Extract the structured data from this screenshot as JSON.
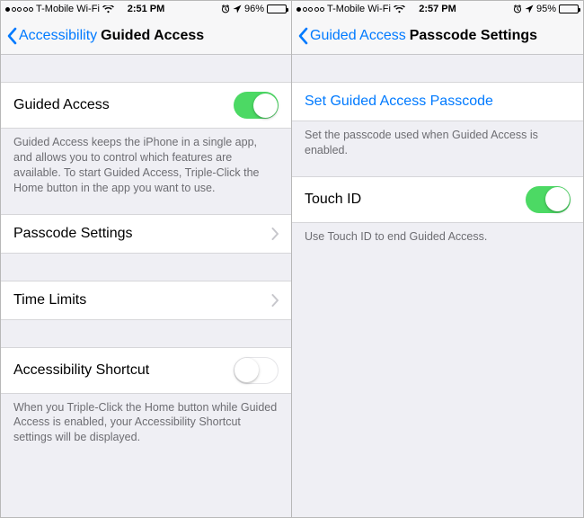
{
  "left": {
    "status": {
      "carrier": "T-Mobile Wi-Fi",
      "time": "2:51 PM",
      "battery_pct": "96%",
      "signal_dots_filled": 1
    },
    "nav": {
      "back": "Accessibility",
      "title": "Guided Access"
    },
    "rows": {
      "guided_access": "Guided Access",
      "guided_access_on": true,
      "guided_access_foot": "Guided Access keeps the iPhone in a single app, and allows you to control which features are available. To start Guided Access, Triple-Click the Home button in the app you want to use.",
      "passcode_settings": "Passcode Settings",
      "time_limits": "Time Limits",
      "accessibility_shortcut": "Accessibility Shortcut",
      "accessibility_shortcut_on": false,
      "accessibility_shortcut_foot": "When you Triple-Click the Home button while Guided Access is enabled, your Accessibility Shortcut settings will be displayed."
    }
  },
  "right": {
    "status": {
      "carrier": "T-Mobile Wi-Fi",
      "time": "2:57 PM",
      "battery_pct": "95%",
      "signal_dots_filled": 1
    },
    "nav": {
      "back": "Guided Access",
      "title": "Passcode Settings"
    },
    "rows": {
      "set_passcode": "Set Guided Access Passcode",
      "set_passcode_foot": "Set the passcode used when Guided Access is enabled.",
      "touch_id": "Touch ID",
      "touch_id_on": true,
      "touch_id_foot": "Use Touch ID to end Guided Access."
    }
  }
}
